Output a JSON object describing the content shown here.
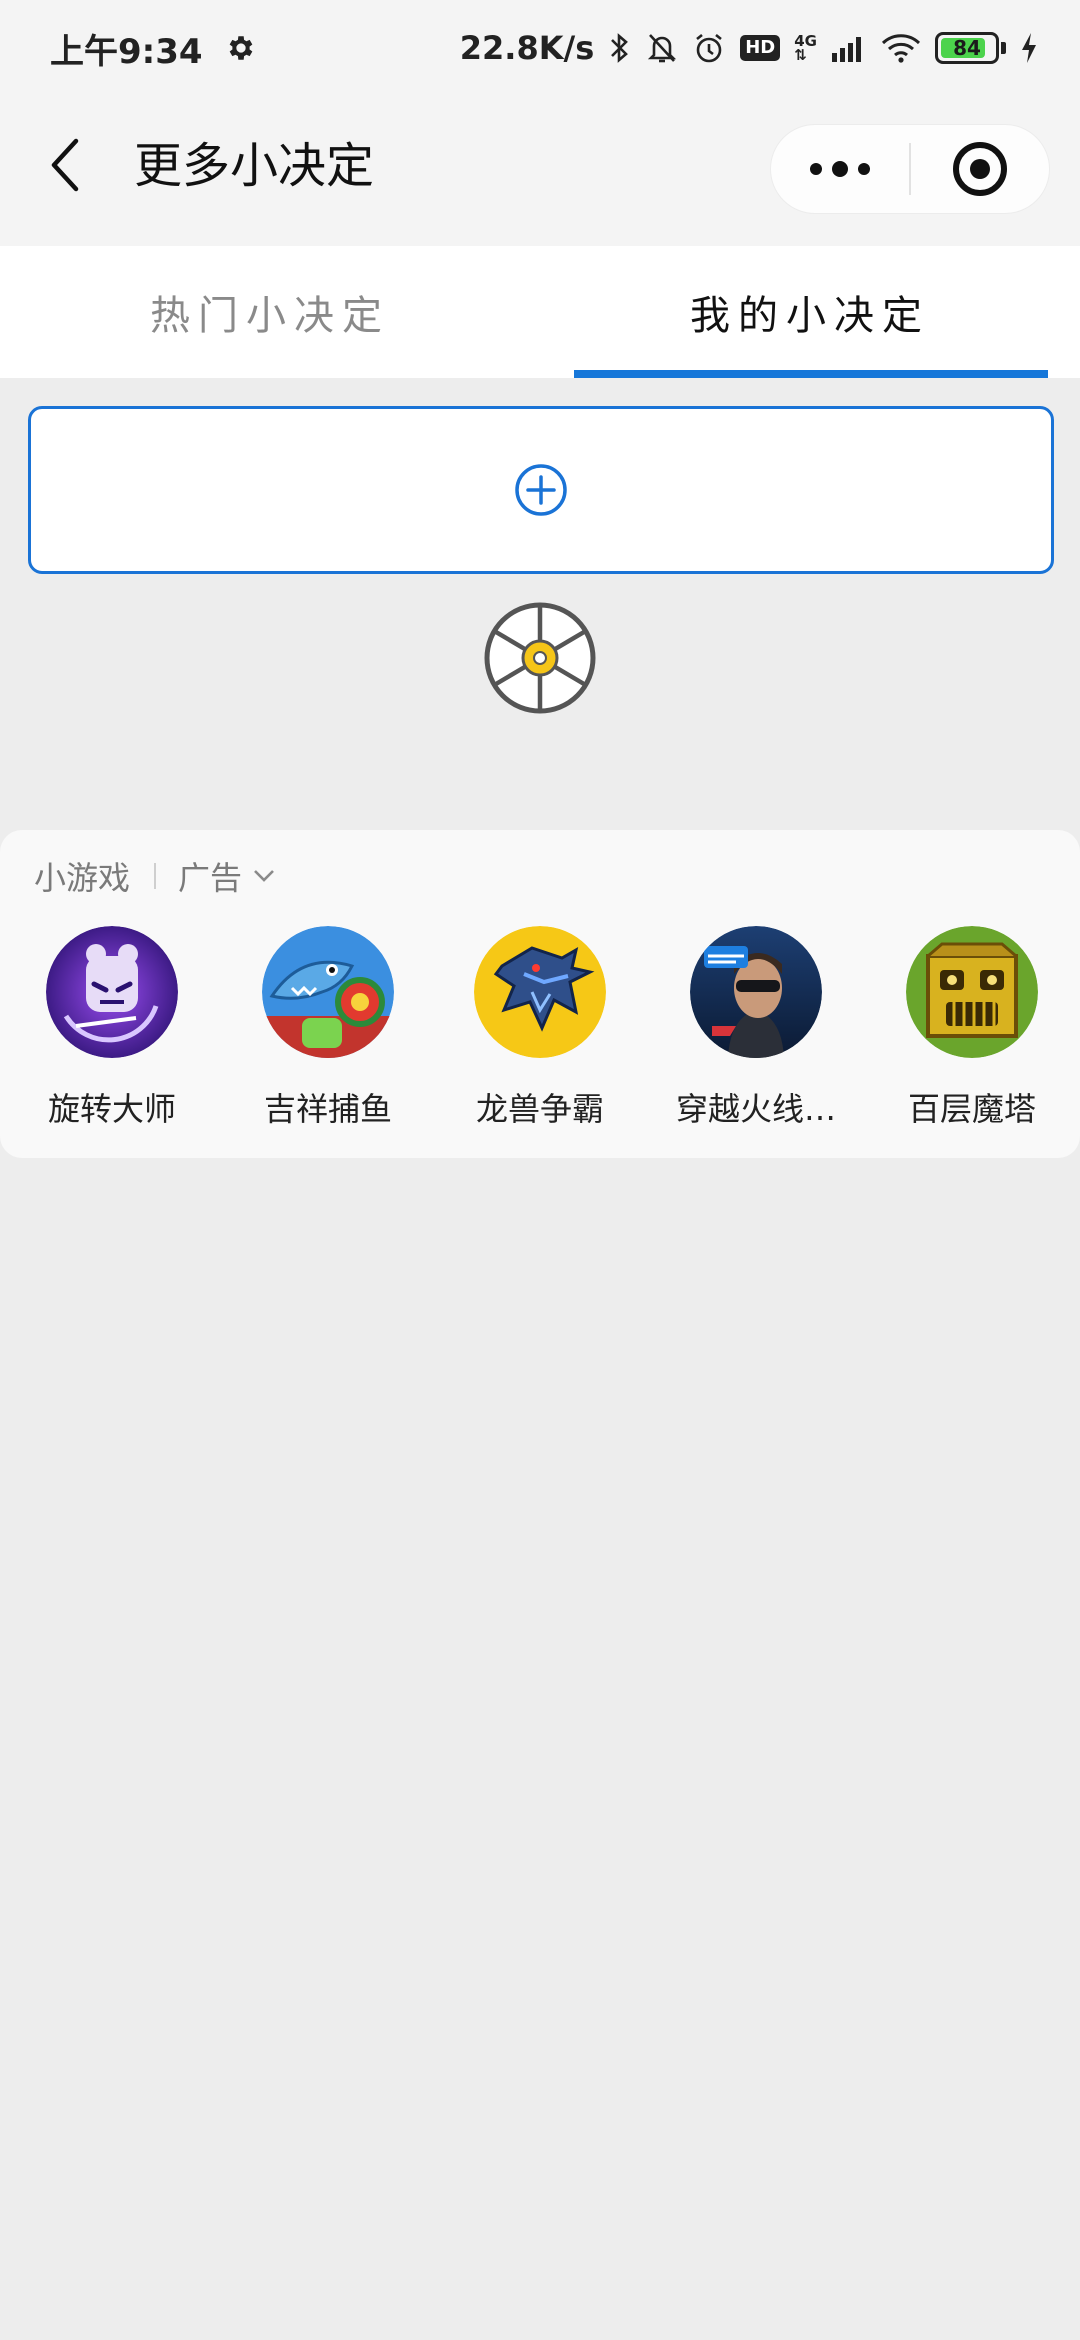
{
  "status_bar": {
    "time": "上午9:34",
    "speed": "22.8K/s",
    "hd": "HD",
    "network": "4G",
    "battery": "84",
    "battery_level": 0.84,
    "icons": [
      "settings-gear-icon",
      "bluetooth-icon",
      "mute-bell-icon",
      "alarm-icon",
      "hd-icon",
      "signal-icon",
      "wifi-icon",
      "battery-icon",
      "charging-icon"
    ]
  },
  "nav": {
    "title": "更多小决定",
    "icons": [
      "back-arrow-icon",
      "more-dots-icon",
      "target-icon"
    ]
  },
  "tabs": [
    {
      "label": "热门小决定",
      "active": false
    },
    {
      "label": "我的小决定",
      "active": true
    }
  ],
  "accent_color": "#1677d9",
  "add_card": {
    "icon": "plus-circle-icon"
  },
  "wheel": {
    "icon": "spinner-wheel-icon"
  },
  "mini_games": {
    "section_label": "小游戏",
    "ad_label": "广告",
    "items": [
      {
        "name": "旋转大师",
        "icon": "game-spin-master-icon"
      },
      {
        "name": "吉祥捕鱼",
        "icon": "game-fishing-icon"
      },
      {
        "name": "龙兽争霸",
        "icon": "game-dragon-icon"
      },
      {
        "name": "穿越火线…",
        "icon": "game-crossfire-icon"
      },
      {
        "name": "百层魔塔",
        "icon": "game-tower-icon"
      }
    ]
  }
}
